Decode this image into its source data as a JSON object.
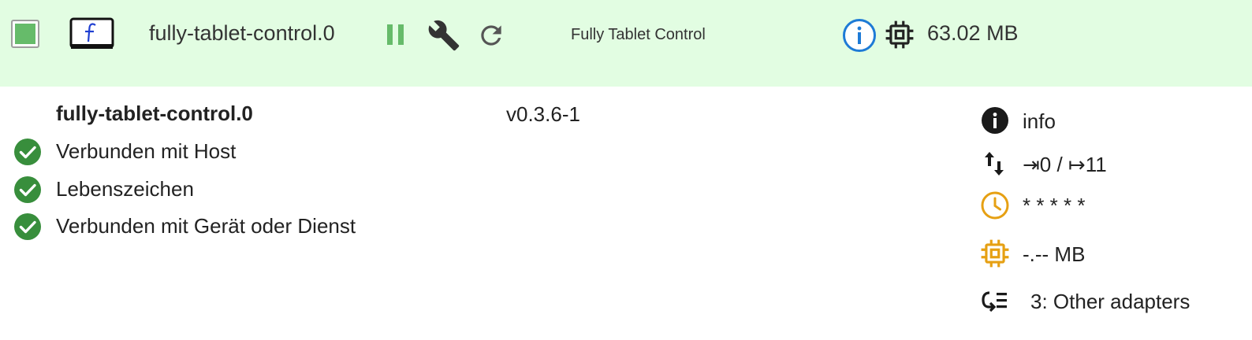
{
  "header": {
    "status_color": "#66bb6a",
    "logo_icon": "fully-tablet-logo-icon",
    "instance_name": "fully-tablet-control.0",
    "title": "Fully Tablet Control",
    "memory": "63.02 MB",
    "icons": [
      "pause-icon",
      "wrench-icon",
      "reload-icon",
      "info-circle-icon",
      "chip-icon"
    ]
  },
  "details": {
    "instance_name": "fully-tablet-control.0",
    "version": "v0.3.6-1",
    "status_items": [
      {
        "label": "Verbunden mit Host",
        "icon": "check-circle-icon"
      },
      {
        "label": "Lebenszeichen",
        "icon": "check-circle-icon"
      },
      {
        "label": "Verbunden mit Gerät oder Dienst",
        "icon": "check-circle-icon"
      }
    ]
  },
  "stats": {
    "loglevel": "info",
    "events": "⇥0 / ↦11",
    "schedule": "* * * * *",
    "memory": "-.-- MB",
    "tier": "3: Other adapters"
  },
  "colors": {
    "header_bg": "#e2fde2",
    "green": "#66bb6a",
    "check_green": "#388e3c",
    "info_blue": "#1e7bd6",
    "orange": "#e6a013"
  }
}
